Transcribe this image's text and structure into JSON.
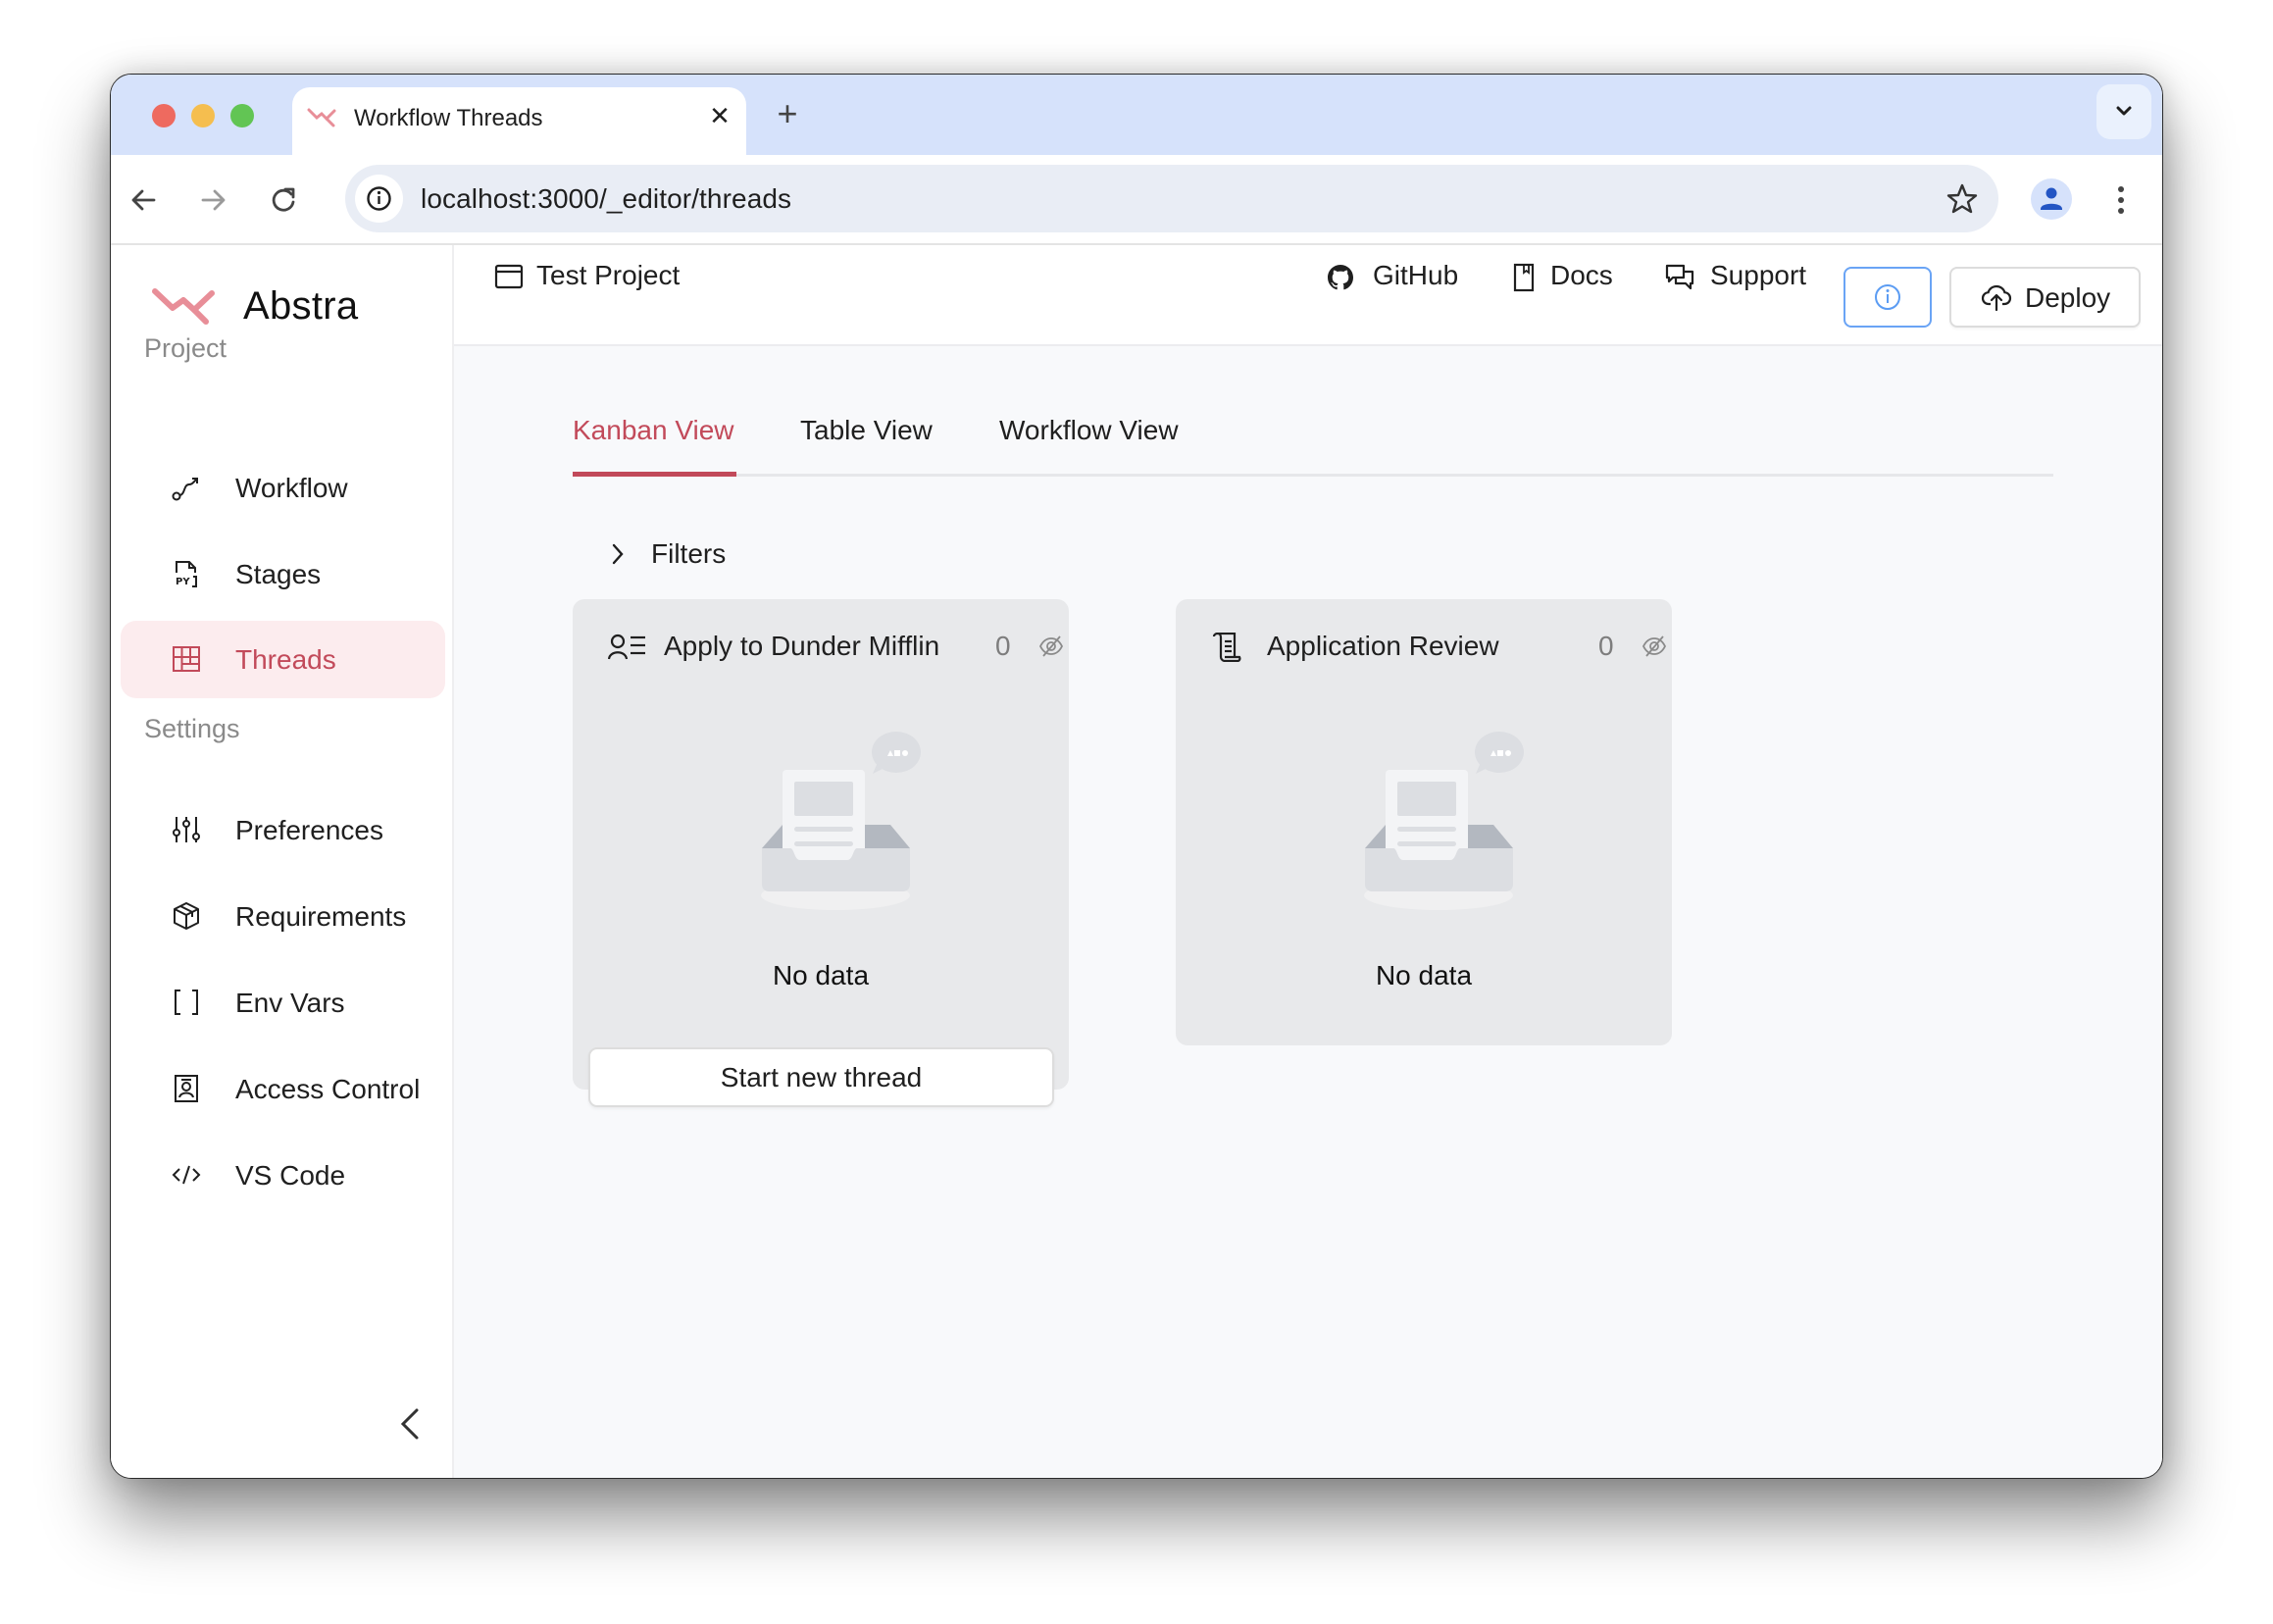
{
  "browser": {
    "tab_title": "Workflow Threads",
    "tab_close_glyph": "✕",
    "new_tab_glyph": "+",
    "url": "localhost:3000/_editor/threads",
    "traffic_lights": {
      "close": "#ee6a5f",
      "minimize": "#f5be4f",
      "maximize": "#62c554"
    }
  },
  "brand": {
    "name": "Abstra",
    "accent": "#c24a5a",
    "logo_color": "#e88e98"
  },
  "sidebar": {
    "sections": [
      {
        "label": "Project",
        "items": [
          {
            "label": "Workflow",
            "icon": "workflow-icon",
            "active": false
          },
          {
            "label": "Stages",
            "icon": "python-file-icon",
            "active": false
          },
          {
            "label": "Threads",
            "icon": "kanban-icon",
            "active": true
          }
        ]
      },
      {
        "label": "Settings",
        "items": [
          {
            "label": "Preferences",
            "icon": "sliders-icon",
            "active": false
          },
          {
            "label": "Requirements",
            "icon": "package-icon",
            "active": false
          },
          {
            "label": "Env Vars",
            "icon": "brackets-icon",
            "active": false
          },
          {
            "label": "Access Control",
            "icon": "user-badge-icon",
            "active": false
          },
          {
            "label": "VS Code",
            "icon": "code-icon",
            "active": false
          }
        ]
      }
    ],
    "collapse_icon": "chevron-left-icon"
  },
  "header": {
    "project_name": "Test Project",
    "links": [
      {
        "label": "GitHub",
        "icon": "github-icon"
      },
      {
        "label": "Docs",
        "icon": "book-icon"
      },
      {
        "label": "Support",
        "icon": "chat-icon"
      }
    ],
    "info_icon": "info-icon",
    "deploy_label": "Deploy"
  },
  "main": {
    "view_tabs": [
      {
        "label": "Kanban View",
        "active": true
      },
      {
        "label": "Table View",
        "active": false
      },
      {
        "label": "Workflow View",
        "active": false
      }
    ],
    "filters_label": "Filters",
    "columns": [
      {
        "title": "Apply to Dunder Mifflin",
        "icon": "user-list-icon",
        "count": "0",
        "empty_text": "No data",
        "action_label": "Start new thread"
      },
      {
        "title": "Application Review",
        "icon": "scroll-icon",
        "count": "0",
        "empty_text": "No data"
      }
    ]
  }
}
